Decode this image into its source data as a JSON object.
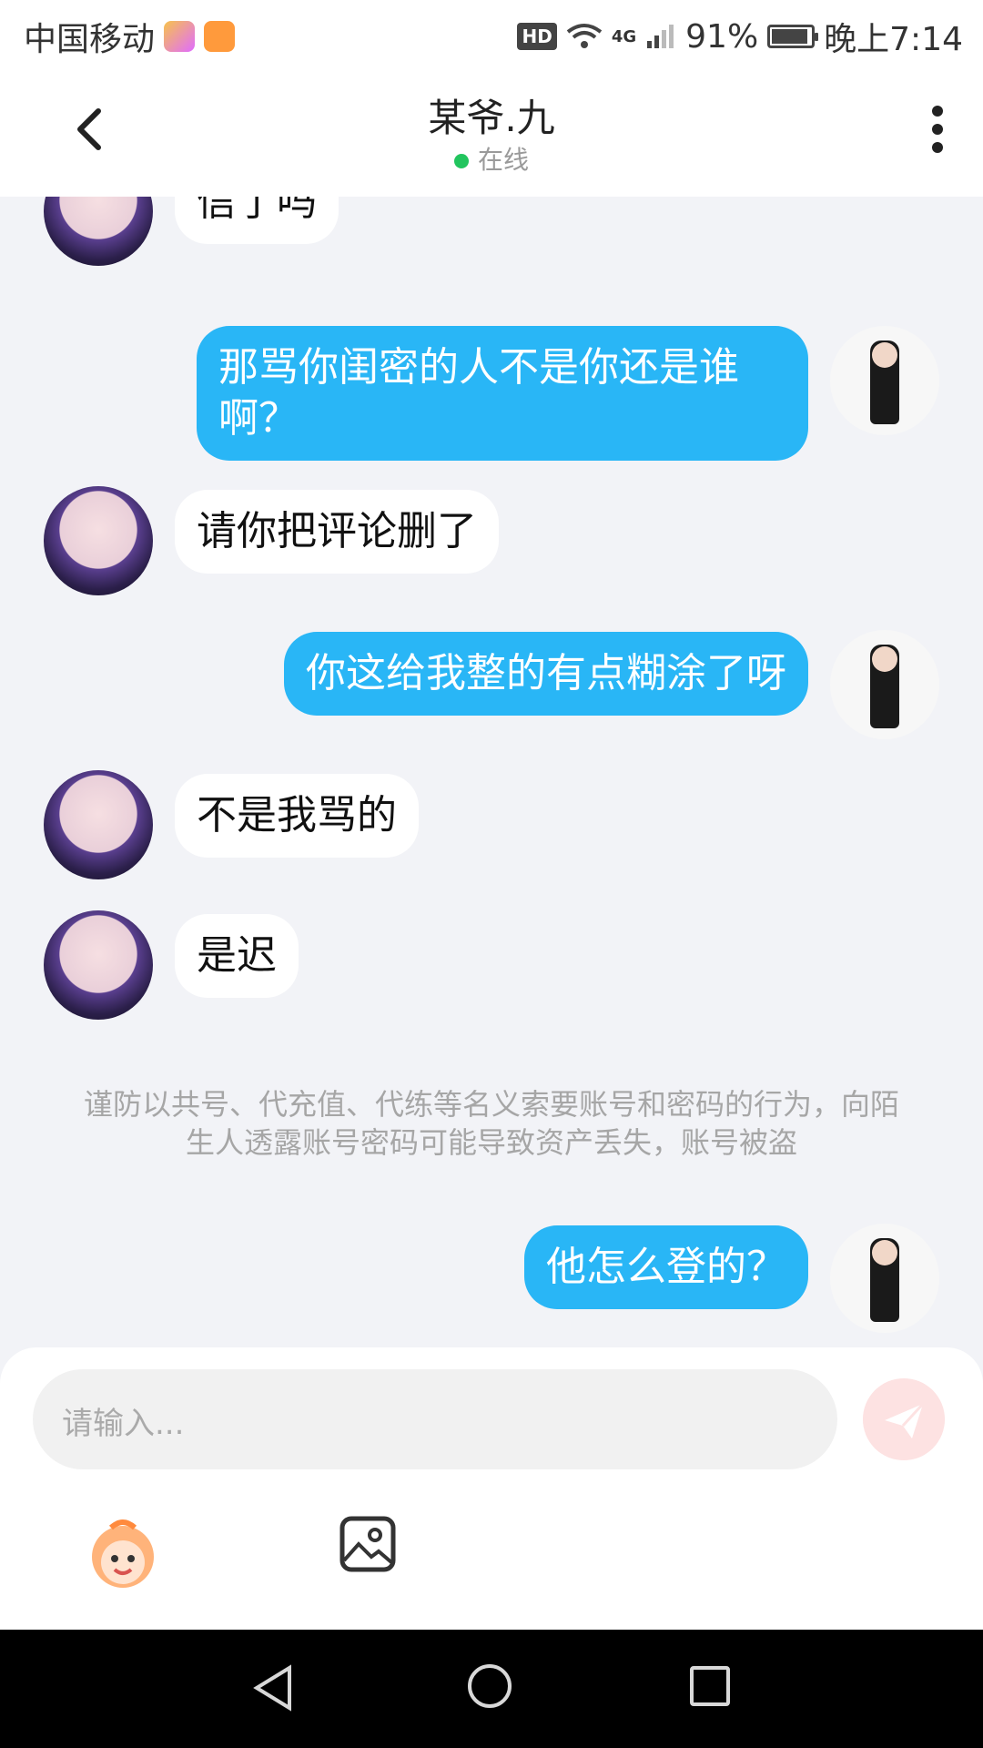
{
  "status_bar": {
    "carrier": "中国移动",
    "hd": "HD",
    "network": "4G",
    "battery_percent": "91%",
    "time": "晚上7:14",
    "icons": [
      "app-icon-1",
      "app-icon-2",
      "wifi-icon",
      "signal-icon",
      "battery-icon"
    ]
  },
  "header": {
    "title": "某爷.九",
    "status": "在线"
  },
  "messages": [
    {
      "side": "left",
      "text": "信了吗"
    },
    {
      "side": "right",
      "text": "那骂你闺密的人不是你还是谁啊？"
    },
    {
      "side": "left",
      "text": "请你把评论删了"
    },
    {
      "side": "right",
      "text": "你这给我整的有点糊涂了呀"
    },
    {
      "side": "left",
      "text": "不是我骂的"
    },
    {
      "side": "left",
      "text": "是迟"
    },
    {
      "side": "right",
      "text": "他怎么登的？"
    }
  ],
  "notice": "谨防以共号、代充值、代练等名义索要账号和密码的行为，向陌生人透露账号密码可能导致资产丢失，账号被盗",
  "composer": {
    "placeholder": "请输入...",
    "send_icon": "send-icon",
    "emoji_icon": "emoji-face-icon",
    "image_icon": "image-icon"
  },
  "navbar": {
    "back_icon": "back-triangle-icon",
    "home_icon": "home-circle-icon",
    "recent_icon": "recent-square-icon"
  },
  "colors": {
    "accent_blue": "#29b6f6",
    "online_green": "#22c55e",
    "chat_background": "#f2f3f7"
  }
}
